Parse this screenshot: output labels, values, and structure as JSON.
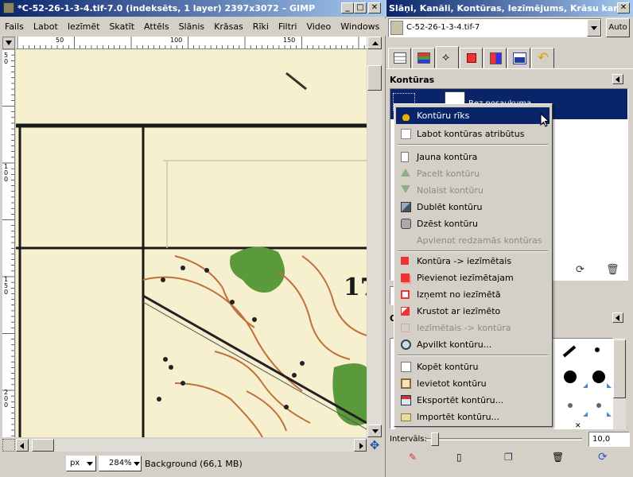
{
  "image_window": {
    "title": "*C-52-26-1-3-4.tif-7.0 (indeksēts, 1 layer) 2397x3072 – GIMP",
    "menu": [
      "Fails",
      "Labot",
      "Iezīmēt",
      "Skatīt",
      "Attēls",
      "Slānis",
      "Krāsas",
      "Rīki",
      "Filtri",
      "Video",
      "Windows",
      "Pa"
    ],
    "ruler_top_ticks": [
      "50",
      "100",
      "150"
    ],
    "ruler_left_ticks": [
      "50",
      "100",
      "150",
      "200"
    ],
    "map_labels": [
      "17"
    ],
    "status": {
      "unit": "px",
      "zoom": "284%",
      "info": "Background (66,1 MB)"
    }
  },
  "dock": {
    "title": "Slāņi, Kanāli, Kontūras, Iezīmējums, Krāsu karte, ...",
    "image_select": "C-52-26-1-3-4.tif-7",
    "auto_button": "Auto",
    "panel_title": "Kontūras",
    "path_name": "Bez nosaukuma",
    "brushes_letter": "O",
    "interval_label": "Intervāls:",
    "interval_value": "10,0"
  },
  "context_menu": {
    "items": [
      {
        "label": "Kontūru rīks",
        "state": "selected",
        "icon": "pen-tool-icon"
      },
      {
        "label": "Labot kontūras atribūtus",
        "state": "enabled",
        "icon": "edit-attributes-icon"
      },
      {
        "label": "Jauna kontūra",
        "state": "enabled",
        "icon": "new-page-icon"
      },
      {
        "label": "Pacelt kontūru",
        "state": "disabled",
        "icon": "arrow-up-icon"
      },
      {
        "label": "Nolaist kontūru",
        "state": "disabled",
        "icon": "arrow-down-icon"
      },
      {
        "label": "Dublēt kontūru",
        "state": "enabled",
        "icon": "duplicate-icon"
      },
      {
        "label": "Dzēst kontūru",
        "state": "enabled",
        "icon": "trash-icon"
      },
      {
        "label": "Apvienot redzamās kontūras",
        "state": "disabled",
        "icon": ""
      },
      {
        "label": "Kontūra -> iezīmētais",
        "state": "enabled",
        "icon": "path-to-selection-icon"
      },
      {
        "label": "Pievienot iezīmētajam",
        "state": "enabled",
        "icon": "add-selection-icon"
      },
      {
        "label": "Izņemt no iezīmētā",
        "state": "enabled",
        "icon": "subtract-selection-icon"
      },
      {
        "label": "Krustot ar iezīmēto",
        "state": "enabled",
        "icon": "intersect-selection-icon"
      },
      {
        "label": "Iezīmētais -> kontūra",
        "state": "disabled",
        "icon": "selection-to-path-icon"
      },
      {
        "label": "Apvilkt kontūru...",
        "state": "enabled",
        "icon": "stroke-path-icon"
      },
      {
        "label": "Kopēt kontūru",
        "state": "enabled",
        "icon": "copy-icon"
      },
      {
        "label": "Ievietot kontūru",
        "state": "enabled",
        "icon": "paste-icon"
      },
      {
        "label": "Eksportēt kontūru...",
        "state": "enabled",
        "icon": "save-icon"
      },
      {
        "label": "Importēt kontūru...",
        "state": "enabled",
        "icon": "folder-icon"
      }
    ]
  },
  "colors": {
    "title_start": "#0a246a",
    "title_end": "#a6caf0",
    "selection": "#0a246a",
    "map_paper": "#f7f0cf",
    "map_contour": "#c0703c",
    "map_green": "#5a9a3a"
  }
}
